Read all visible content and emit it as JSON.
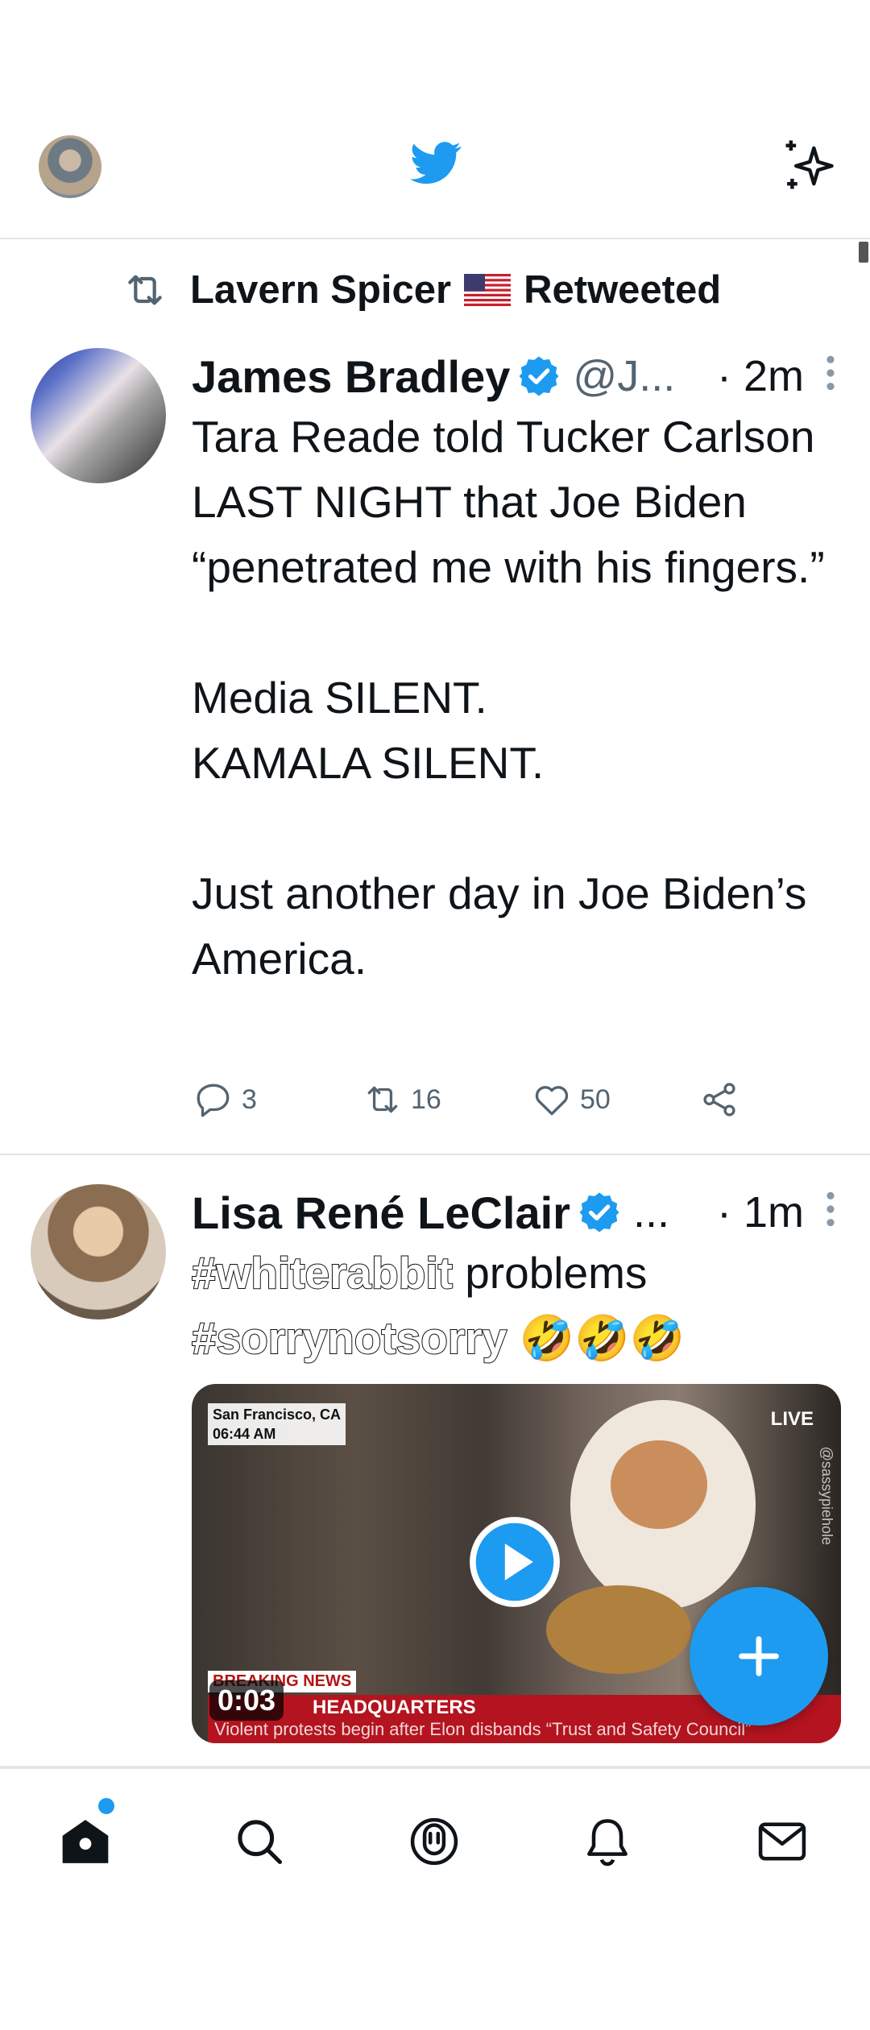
{
  "colors": {
    "accent": "#1d9bf0",
    "text": "#0f1419",
    "secondary": "#536471",
    "divider": "#e1e6ea"
  },
  "header": {
    "icons": [
      "profile-avatar",
      "twitter-bird-icon",
      "sparkle-icon"
    ]
  },
  "retweet_banner": {
    "user": "Lavern Spicer",
    "flag": "🇺🇸",
    "suffix": "Retweeted"
  },
  "tweets": [
    {
      "name": "James Bradley",
      "handle": "@J...",
      "time": "· 2m",
      "text": "Tara Reade told Tucker Carlson LAST NIGHT that Joe Biden “penetrated me with his fingers.”\n\nMedia SILENT.\nKAMALA SILENT.\n\nJust another day in Joe Biden’s America.",
      "replies": "3",
      "retweets": "16",
      "likes": "50"
    },
    {
      "name": "Lisa René LeClair",
      "handle": "...",
      "time": "· 1m",
      "hashtag1": "#whiterabbit",
      "text_mid": " problems",
      "hashtag2": "#sorrynotsorry",
      "emojis": " 🤣🤣🤣",
      "media": {
        "location": "San Francisco, CA",
        "clock": "06:44 AM",
        "live": "LIVE",
        "breaking": "BREAKING NEWS",
        "headline": "HEADQUARTERS",
        "subline": "Violent protests begin after Elon disbands “Trust and Safety Council”",
        "duration": "0:03",
        "watermark": "@sassypiehole"
      }
    }
  ],
  "bottom_nav": [
    "home-icon",
    "search-icon",
    "spaces-icon",
    "notifications-icon",
    "messages-icon"
  ]
}
